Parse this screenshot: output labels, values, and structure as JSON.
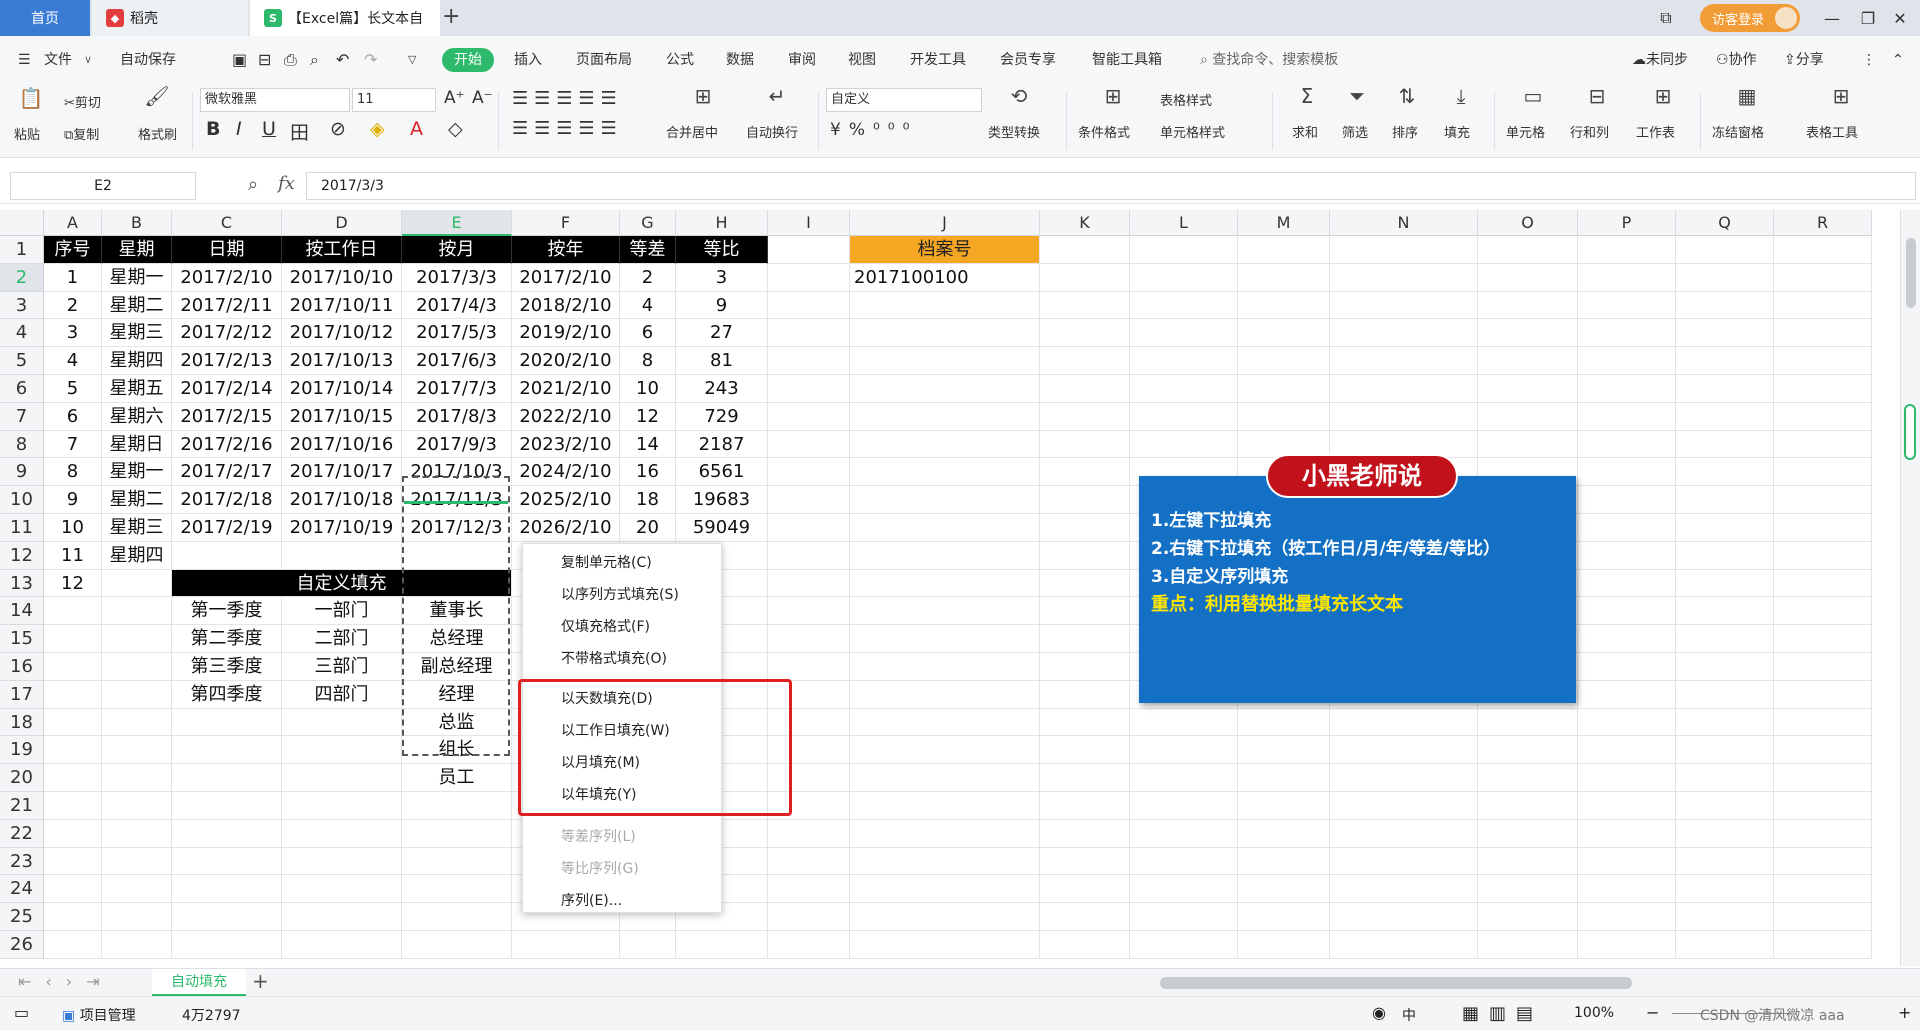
{
  "titlebar": {
    "home_tab": "首页",
    "daoke_tab": "稻壳",
    "doc_tab": "【Excel篇】长文本自",
    "new_tab": "+",
    "login": "访客登录"
  },
  "menubar": {
    "file": "文件",
    "autosave": "自动保存",
    "items": [
      "开始",
      "插入",
      "页面布局",
      "公式",
      "数据",
      "审阅",
      "视图",
      "开发工具",
      "会员专享",
      "智能工具箱"
    ],
    "search": "查找命令、搜索模板",
    "sync": "未同步",
    "collab": "协作",
    "share": "分享"
  },
  "ribbon": {
    "paste": "粘贴",
    "cut": "剪切",
    "copy": "复制",
    "format_painter": "格式刷",
    "font_name": "微软雅黑",
    "font_size": "11",
    "merge_center": "合并居中",
    "wrap": "自动换行",
    "number_format": "自定义",
    "type_convert": "类型转换",
    "cond_format": "条件格式",
    "table_style": "表格样式",
    "cell_style": "单元格样式",
    "sum": "求和",
    "filter": "筛选",
    "sort": "排序",
    "fill": "填充",
    "cell": "单元格",
    "rowcol": "行和列",
    "sheet": "工作表",
    "freeze": "冻结窗格",
    "table_tools": "表格工具"
  },
  "formula": {
    "name_box": "E2",
    "fx": "fx",
    "value": "2017/3/3"
  },
  "columns": [
    "A",
    "B",
    "C",
    "D",
    "E",
    "F",
    "G",
    "H",
    "I",
    "J",
    "K",
    "L",
    "M",
    "N",
    "O",
    "P",
    "Q",
    "R"
  ],
  "rows": [
    "1",
    "2",
    "3",
    "4",
    "5",
    "6",
    "7",
    "8",
    "9",
    "10",
    "11",
    "12",
    "13",
    "14",
    "15",
    "16",
    "17",
    "18",
    "19",
    "20",
    "21",
    "22",
    "23",
    "24",
    "25",
    "26"
  ],
  "table": {
    "headers": [
      "序号",
      "星期",
      "日期",
      "按工作日",
      "按月",
      "按年",
      "等差",
      "等比"
    ],
    "rows": [
      [
        "1",
        "星期一",
        "2017/2/10",
        "2017/10/10",
        "2017/3/3",
        "2017/2/10",
        "2",
        "3"
      ],
      [
        "2",
        "星期二",
        "2017/2/11",
        "2017/10/11",
        "2017/4/3",
        "2018/2/10",
        "4",
        "9"
      ],
      [
        "3",
        "星期三",
        "2017/2/12",
        "2017/10/12",
        "2017/5/3",
        "2019/2/10",
        "6",
        "27"
      ],
      [
        "4",
        "星期四",
        "2017/2/13",
        "2017/10/13",
        "2017/6/3",
        "2020/2/10",
        "8",
        "81"
      ],
      [
        "5",
        "星期五",
        "2017/2/14",
        "2017/10/14",
        "2017/7/3",
        "2021/2/10",
        "10",
        "243"
      ],
      [
        "6",
        "星期六",
        "2017/2/15",
        "2017/10/15",
        "2017/8/3",
        "2022/2/10",
        "12",
        "729"
      ],
      [
        "7",
        "星期日",
        "2017/2/16",
        "2017/10/16",
        "2017/9/3",
        "2023/2/10",
        "14",
        "2187"
      ],
      [
        "8",
        "星期一",
        "2017/2/17",
        "2017/10/17",
        "2017/10/3",
        "2024/2/10",
        "16",
        "6561"
      ],
      [
        "9",
        "星期二",
        "2017/2/18",
        "2017/10/18",
        "2017/11/3",
        "2025/2/10",
        "18",
        "19683"
      ],
      [
        "10",
        "星期三",
        "2017/2/19",
        "2017/10/19",
        "2017/12/3",
        "2026/2/10",
        "20",
        "59049"
      ],
      [
        "11",
        "星期四",
        "",
        "",
        "",
        "",
        "",
        ""
      ],
      [
        "12",
        "",
        "",
        "",
        "",
        "",
        "",
        ""
      ]
    ],
    "archive_header": "档案号",
    "archive_value": "2017100100"
  },
  "custom_fill": {
    "title": "自定义填充",
    "col_c": [
      "第一季度",
      "第二季度",
      "第三季度",
      "第四季度"
    ],
    "col_d": [
      "一部门",
      "二部门",
      "三部门",
      "四部门"
    ],
    "col_e": [
      "董事长",
      "总经理",
      "副总经理",
      "经理",
      "总监",
      "组长",
      "员工"
    ]
  },
  "context_menu": {
    "items": [
      {
        "label": "复制单元格(C)",
        "disabled": false
      },
      {
        "label": "以序列方式填充(S)",
        "disabled": false
      },
      {
        "label": "仅填充格式(F)",
        "disabled": false
      },
      {
        "label": "不带格式填充(O)",
        "disabled": false
      },
      {
        "label": "以天数填充(D)",
        "disabled": false
      },
      {
        "label": "以工作日填充(W)",
        "disabled": false
      },
      {
        "label": "以月填充(M)",
        "disabled": false
      },
      {
        "label": "以年填充(Y)",
        "disabled": false
      },
      {
        "label": "等差序列(L)",
        "disabled": true
      },
      {
        "label": "等比序列(G)",
        "disabled": true
      },
      {
        "label": "序列(E)...",
        "disabled": false
      }
    ]
  },
  "panel": {
    "title": "小黑老师说",
    "lines": [
      "1.左键下拉填充",
      "2.右键下拉填充（按工作日/月/年/等差/等比）",
      "3.自定义序列填充"
    ],
    "highlight": "重点：利用替换批量填充长文本"
  },
  "sheetbar": {
    "sheet_name": "自动填充",
    "add": "+"
  },
  "statusbar": {
    "project": "项目管理",
    "count": "4万2797",
    "zoom": "100%",
    "watermark": "CSDN @清风微凉 aaa"
  },
  "colors": {
    "accent_green": "#2dba6c",
    "panel_blue": "#1470c4",
    "title_red": "#c1121c",
    "archive_orange": "#f5a623",
    "highlight_yellow": "#ffe600"
  }
}
